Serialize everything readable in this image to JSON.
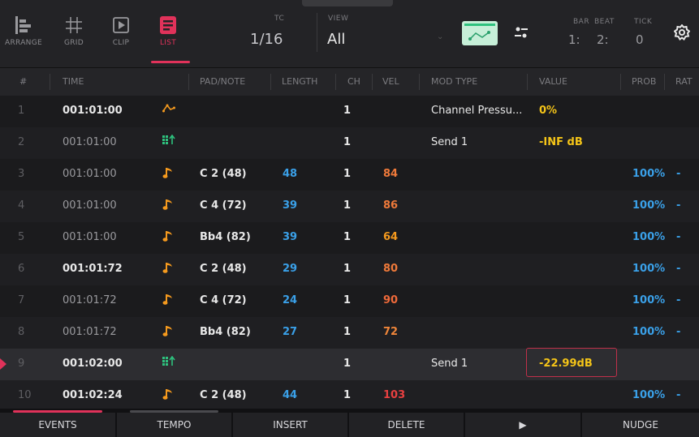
{
  "tabs": [
    {
      "label": "ARRANGE",
      "icon": "arrange-icon"
    },
    {
      "label": "GRID",
      "icon": "grid-icon"
    },
    {
      "label": "CLIP",
      "icon": "clip-icon"
    },
    {
      "label": "LIST",
      "icon": "list-icon",
      "active": true
    }
  ],
  "tc": {
    "label": "TC",
    "value": "1/16"
  },
  "view": {
    "label": "VIEW",
    "value": "All"
  },
  "position": {
    "bar": {
      "label": "BAR",
      "value": "1:"
    },
    "beat": {
      "label": "BEAT",
      "value": "2:"
    },
    "tick": {
      "label": "TICK",
      "value": "0"
    }
  },
  "columns": [
    "#",
    "TIME",
    "PAD/NOTE",
    "LENGTH",
    "CH",
    "VEL",
    "MOD TYPE",
    "VALUE",
    "PROB",
    "RAT"
  ],
  "rows": [
    {
      "idx": "1",
      "time": "001:01:00",
      "icon": "automation-icon",
      "note": "",
      "length": "",
      "ch": "1",
      "vel": "",
      "mod": "Channel Pressu...",
      "value": "0%",
      "prob": "",
      "rat": ""
    },
    {
      "idx": "2",
      "time": "001:01:00",
      "icon": "pad-send-icon",
      "note": "",
      "length": "",
      "ch": "1",
      "vel": "",
      "mod": "Send 1",
      "value": "-INF dB",
      "prob": "",
      "rat": ""
    },
    {
      "idx": "3",
      "time": "001:01:00",
      "icon": "note-icon",
      "note": "C 2 (48)",
      "length": "48",
      "ch": "1",
      "vel": "84",
      "mod": "",
      "value": "",
      "prob": "100%",
      "rat": "-"
    },
    {
      "idx": "4",
      "time": "001:01:00",
      "icon": "note-icon",
      "note": "C 4 (72)",
      "length": "39",
      "ch": "1",
      "vel": "86",
      "mod": "",
      "value": "",
      "prob": "100%",
      "rat": "-"
    },
    {
      "idx": "5",
      "time": "001:01:00",
      "icon": "note-icon",
      "note": "Bb4 (82)",
      "length": "39",
      "ch": "1",
      "vel": "64",
      "mod": "",
      "value": "",
      "prob": "100%",
      "rat": "-"
    },
    {
      "idx": "6",
      "time": "001:01:72",
      "icon": "note-icon",
      "note": "C 2 (48)",
      "length": "29",
      "ch": "1",
      "vel": "80",
      "mod": "",
      "value": "",
      "prob": "100%",
      "rat": "-"
    },
    {
      "idx": "7",
      "time": "001:01:72",
      "icon": "note-icon",
      "note": "C 4 (72)",
      "length": "24",
      "ch": "1",
      "vel": "90",
      "mod": "",
      "value": "",
      "prob": "100%",
      "rat": "-"
    },
    {
      "idx": "8",
      "time": "001:01:72",
      "icon": "note-icon",
      "note": "Bb4 (82)",
      "length": "27",
      "ch": "1",
      "vel": "72",
      "mod": "",
      "value": "",
      "prob": "100%",
      "rat": "-"
    },
    {
      "idx": "9",
      "time": "001:02:00",
      "icon": "pad-send-icon",
      "note": "",
      "length": "",
      "ch": "1",
      "vel": "",
      "mod": "Send 1",
      "value": "-22.99dB",
      "prob": "",
      "rat": ""
    },
    {
      "idx": "10",
      "time": "001:02:24",
      "icon": "note-icon",
      "note": "C 2 (48)",
      "length": "44",
      "ch": "1",
      "vel": "103",
      "mod": "",
      "value": "",
      "prob": "100%",
      "rat": "-"
    }
  ],
  "buttons": [
    "EVENTS",
    "TEMPO",
    "INSERT",
    "DELETE",
    "▶",
    "NUDGE"
  ],
  "colors": {
    "accent": "#e0325a",
    "note_icon": "#f59a1e",
    "send_icon": "#2ec27e",
    "value": "#f5c518",
    "prob": "#3aa0e8",
    "length": "#3aa0e8"
  }
}
